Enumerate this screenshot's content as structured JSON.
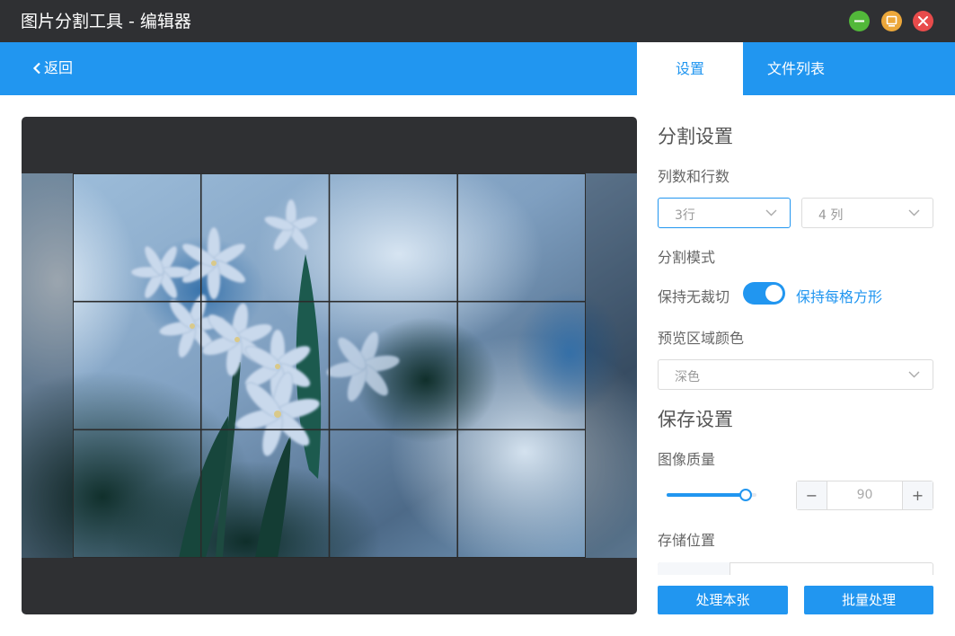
{
  "window": {
    "title": "图片分割工具 - 编辑器",
    "controls": [
      "minimize-icon",
      "maximize-icon",
      "close-icon"
    ],
    "control_colors": {
      "minimize": "#52b83a",
      "maximize": "#eca73a",
      "close": "#e84b4b"
    }
  },
  "header": {
    "back_label": "返回",
    "tabs": [
      {
        "label": "设置",
        "active": true
      },
      {
        "label": "文件列表",
        "active": false
      }
    ]
  },
  "preview": {
    "rows": 3,
    "columns": 4,
    "background_color": "#2f3033"
  },
  "settings": {
    "split_title": "分割设置",
    "cols_rows_label": "列数和行数",
    "rows_select": {
      "value": "3行"
    },
    "cols_select": {
      "value": "4 列"
    },
    "mode_label": "分割模式",
    "mode_toggle": {
      "off_label": "保持无裁切",
      "on_label": "保持每格方形",
      "checked": true
    },
    "preview_color_label": "预览区域颜色",
    "preview_color_select": {
      "value": "深色"
    },
    "save_title": "保存设置",
    "quality_label": "图像质量",
    "quality": {
      "value": "90",
      "fraction": 0.9,
      "minus": "−",
      "plus": "+"
    },
    "storage_label": "存储位置"
  },
  "actions": {
    "process_one": "处理本张",
    "process_batch": "批量处理"
  },
  "colors": {
    "accent": "#2196f0",
    "titlebar": "#2f3033"
  }
}
